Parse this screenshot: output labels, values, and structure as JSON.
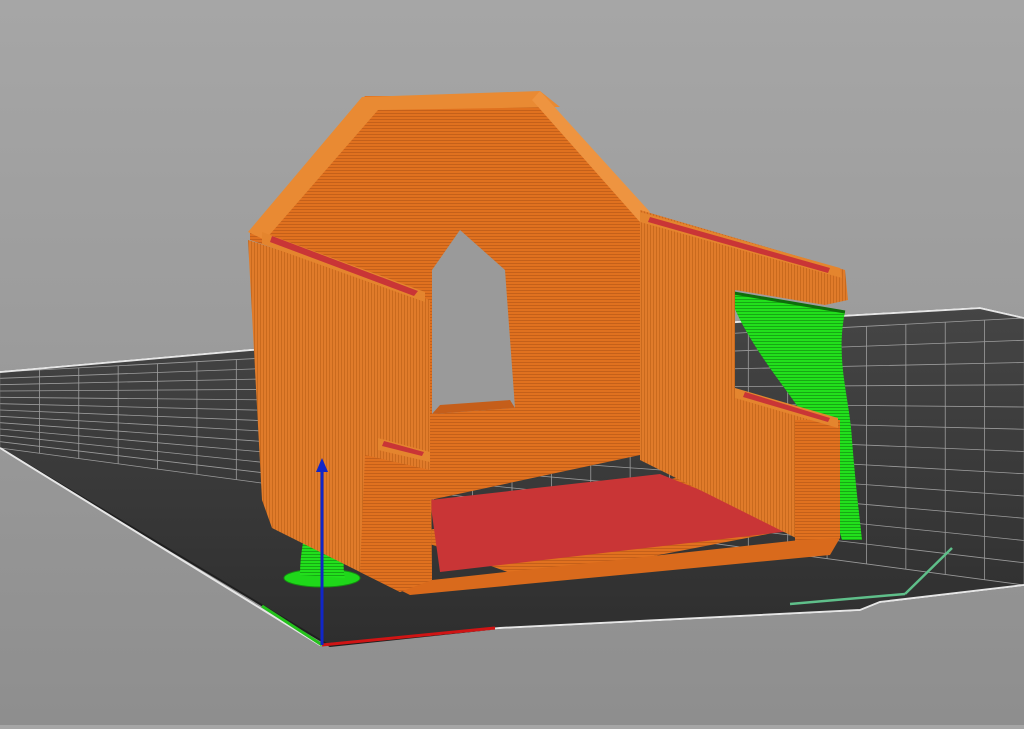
{
  "viewport": {
    "background_top": "#a6a6a6",
    "background_bottom": "#8e8e8e"
  },
  "colors": {
    "bed": "#3b3b3b",
    "bed_edge": "#1e1e1e",
    "grid_line": "#cfcfcf",
    "grid_border": "#e8e8e8",
    "perimeter": "#e07020",
    "perimeter_dark": "#b8561a",
    "top_solid": "#ca3536",
    "support": "#1fd81a",
    "support_dark": "#159a12",
    "axis_x": "#d01414",
    "axis_y": "#24c21c",
    "axis_z": "#1026c8",
    "tool_marker": "#5fbf8a"
  },
  "objects": {
    "model": "printed-part",
    "supports": [
      "left-tree-support",
      "right-tree-support"
    ]
  },
  "icons": [
    "axis-x-icon",
    "axis-y-icon",
    "axis-z-icon",
    "toolhead-marker-icon"
  ]
}
